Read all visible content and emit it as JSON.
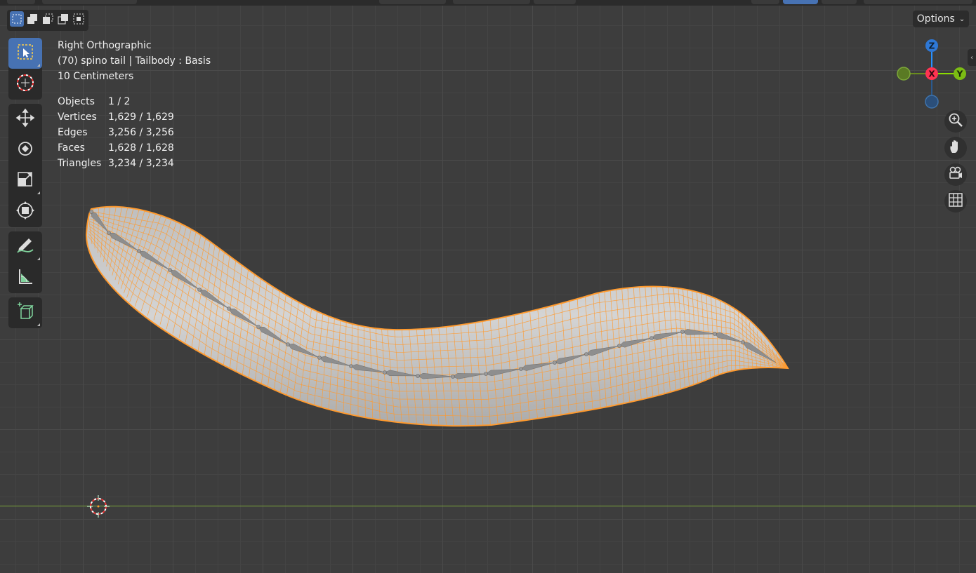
{
  "viewport": {
    "view_name": "Right Orthographic",
    "object_info": "(70) spino tail | Tailbody : Basis",
    "scale_info": "10 Centimeters",
    "stats": [
      {
        "label": "Objects",
        "value": "1 / 2"
      },
      {
        "label": "Vertices",
        "value": "1,629 / 1,629"
      },
      {
        "label": "Edges",
        "value": "3,256 / 3,256"
      },
      {
        "label": "Faces",
        "value": "1,628 / 1,628"
      },
      {
        "label": "Triangles",
        "value": "3,234 / 3,234"
      }
    ]
  },
  "header": {
    "options_label": "Options"
  },
  "gizmo": {
    "x_label": "X",
    "y_label": "Y",
    "z_label": "Z",
    "colors": {
      "x": "#ff3352",
      "y": "#8bdc00",
      "z": "#2890ff",
      "neg_y": "#6a8c1e",
      "neg_z": "#2b5a8e"
    }
  },
  "selection_color": "#ff9a2e",
  "tools": [
    "select-box-icon",
    "cursor-icon",
    "move-icon",
    "rotate-icon",
    "scale-icon",
    "transform-icon",
    "annotate-icon",
    "measure-icon",
    "add-cube-icon"
  ],
  "nav": [
    "zoom-icon",
    "hand-pan-icon",
    "camera-icon",
    "grid-icon"
  ]
}
